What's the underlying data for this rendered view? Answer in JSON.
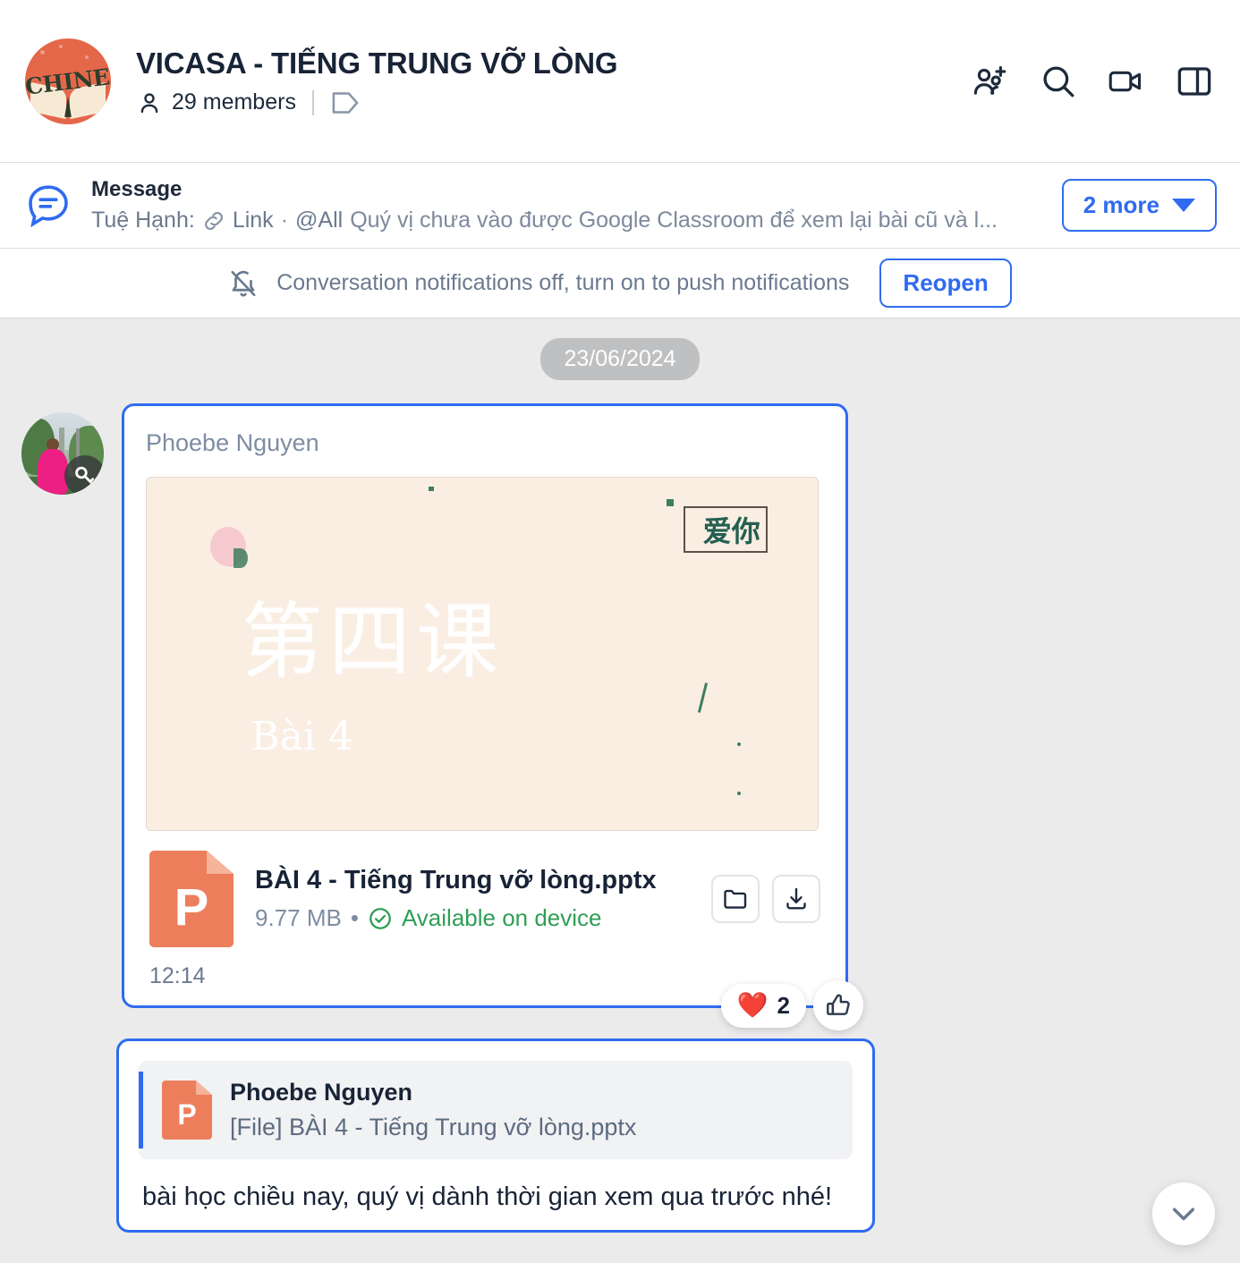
{
  "header": {
    "title": "VICASA - TIẾNG TRUNG VỠ LÒNG",
    "avatar_word": "CHINESE",
    "members": "29 members",
    "icons": {
      "add_member": "add-member-icon",
      "search": "search-icon",
      "video": "video-call-icon",
      "panel": "split-panel-icon",
      "tag": "tag-icon",
      "person": "person-icon"
    }
  },
  "pinned": {
    "icon": "pinned-message-icon",
    "title": "Message",
    "author": "Tuệ Hạnh:",
    "link_icon": "link-icon",
    "link_label": "Link",
    "dot": "·",
    "mention": "@All",
    "preview": "Quý vị chưa vào được Google Classroom để xem lại bài cũ và l...",
    "more_label": "2 more"
  },
  "notification": {
    "icon": "bell-off-icon",
    "text": "Conversation notifications off, turn on to push notifications",
    "button_label": "Reopen"
  },
  "chat": {
    "date_chip": "23/06/2024",
    "messages": [
      {
        "sender": "Phoebe Nguyen",
        "avatar_badge": "key-icon",
        "slide": {
          "chinese_title": "第四课",
          "vietnamese_title": "Bài 4",
          "corner_text": "爱你",
          "bg_color": "#faeee3",
          "accent_color": "#236050"
        },
        "file": {
          "icon": "powerpoint-file-icon",
          "letter": "P",
          "name": "BÀI 4 - Tiếng Trung vỡ lòng.pptx",
          "size": "9.77 MB",
          "separator": "•",
          "status_icon": "check-circle-icon",
          "status": "Available on device",
          "open_folder_icon": "folder-icon",
          "download_icon": "download-icon"
        },
        "time": "12:14",
        "reactions": {
          "emoji": "❤️",
          "count": "2",
          "quick_icon": "thumbs-up-icon"
        }
      },
      {
        "quote": {
          "icon": "powerpoint-file-icon",
          "letter": "P",
          "sender": "Phoebe Nguyen",
          "file_label": "[File] BÀI 4 - Tiếng Trung vỡ lòng.pptx"
        },
        "text": "bài học chiều nay, quý vị dành thời gian xem qua trước nhé!"
      }
    ],
    "scroll_icon": "chevron-down-icon"
  },
  "colors": {
    "accent_blue": "#2f6bf0",
    "bg_gray": "#ebebec",
    "text_dark": "#182336",
    "text_muted": "#6b7a90",
    "green": "#2f9e56",
    "orange": "#ec7e5c"
  }
}
